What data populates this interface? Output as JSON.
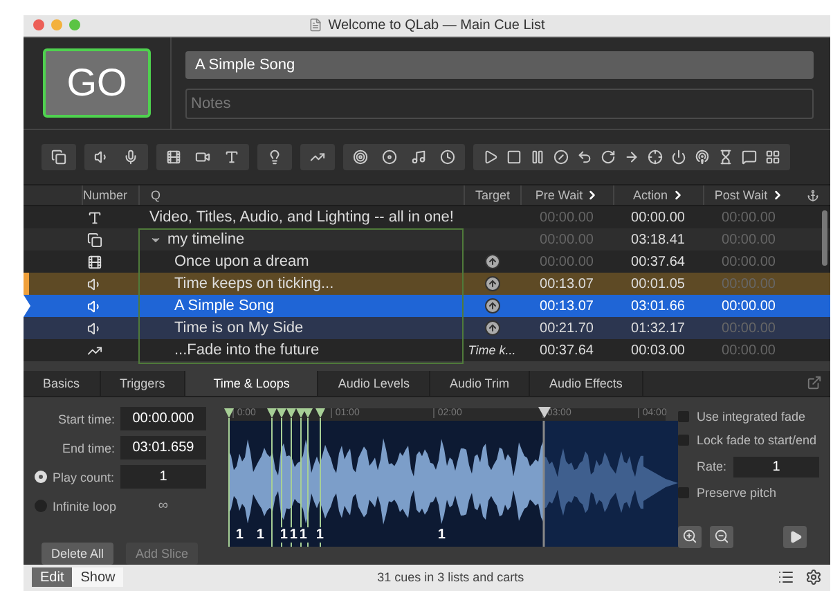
{
  "window": {
    "title": "Welcome to QLab — Main Cue List"
  },
  "go_button": {
    "label": "GO"
  },
  "cue_name": {
    "value": "A Simple Song"
  },
  "notes": {
    "placeholder": "Notes"
  },
  "toolbar_groups": [
    [
      {
        "kind": "group"
      }
    ],
    [
      {
        "kind": "audio"
      },
      {
        "kind": "mic"
      }
    ],
    [
      {
        "kind": "video"
      },
      {
        "kind": "camera"
      },
      {
        "kind": "text"
      }
    ],
    [
      {
        "kind": "light"
      }
    ],
    [
      {
        "kind": "fade"
      }
    ],
    [
      {
        "kind": "network"
      },
      {
        "kind": "midi"
      },
      {
        "kind": "music"
      },
      {
        "kind": "timecode"
      }
    ],
    [
      {
        "kind": "start"
      },
      {
        "kind": "stop"
      },
      {
        "kind": "pause"
      },
      {
        "kind": "load"
      },
      {
        "kind": "reset"
      },
      {
        "kind": "devamp"
      },
      {
        "kind": "goto"
      },
      {
        "kind": "target"
      },
      {
        "kind": "arm"
      },
      {
        "kind": "disarm"
      },
      {
        "kind": "wait"
      },
      {
        "kind": "memo"
      },
      {
        "kind": "script"
      }
    ]
  ],
  "columns": [
    {
      "label": "Number",
      "chevron": false
    },
    {
      "label": "Q",
      "chevron": false
    },
    {
      "label": "Target",
      "chevron": false
    },
    {
      "label": "Pre Wait",
      "chevron": true
    },
    {
      "label": "Action",
      "chevron": true
    },
    {
      "label": "Post Wait",
      "chevron": true
    }
  ],
  "cues": [
    {
      "kind": "text",
      "name": "Video, Titles, Audio, and Lighting -- all in one!",
      "selected": false,
      "pre_wait": "00:00.00",
      "pre_dim": true,
      "action": "00:00.00",
      "post_wait": "00:00.00",
      "post_dim": true
    },
    {
      "kind": "group",
      "name": "my timeline",
      "expanded": true,
      "selected": false,
      "pre_wait": "00:00.00",
      "pre_dim": true,
      "action": "03:18.41",
      "post_wait": "00:00.00",
      "post_dim": true,
      "children": [
        {
          "kind": "video",
          "name": "Once upon a dream",
          "selected": false,
          "target": {
            "kind": "arrow"
          },
          "pre_wait": "00:00.00",
          "pre_dim": true,
          "action": "00:37.64",
          "post_wait": "00:00.00",
          "post_dim": true
        },
        {
          "kind": "audio",
          "name": "Time keeps on ticking...",
          "selected": false,
          "color": "#5e4a25",
          "target": {
            "kind": "arrow"
          },
          "pre_wait": "00:13.07",
          "pre_dim": false,
          "action": "00:01.05",
          "post_wait": "00:00.00",
          "post_dim": true
        },
        {
          "kind": "audio",
          "name": "A Simple Song",
          "selected": true,
          "target": {
            "kind": "arrow"
          },
          "pre_wait": "00:13.07",
          "pre_dim": false,
          "action": "03:01.66",
          "post_wait": "00:00.00",
          "post_dim": false
        },
        {
          "kind": "audio",
          "name": "Time is on My Side",
          "selected": false,
          "color": "#2c3650",
          "target": {
            "kind": "arrow"
          },
          "pre_wait": "00:21.70",
          "pre_dim": false,
          "action": "01:32.17",
          "post_wait": "00:00.00",
          "post_dim": true
        },
        {
          "kind": "fade",
          "name": "...Fade into the future",
          "selected": false,
          "target": {
            "kind": "text",
            "text": "Time k..."
          },
          "pre_wait": "00:37.64",
          "pre_dim": false,
          "action": "00:03.00",
          "post_wait": "00:00.00",
          "post_dim": true
        }
      ]
    }
  ],
  "tabs": [
    {
      "label": "Basics",
      "selected": false
    },
    {
      "label": "Triggers",
      "selected": false
    },
    {
      "label": "Time & Loops",
      "selected": true
    },
    {
      "label": "Audio Levels",
      "selected": false
    },
    {
      "label": "Audio Trim",
      "selected": false
    },
    {
      "label": "Audio Effects",
      "selected": false
    }
  ],
  "start_time": {
    "label": "Start time:",
    "value": "00:00.000"
  },
  "end_time": {
    "label": "End time:",
    "value": "03:01.659"
  },
  "loop_options": [
    {
      "label": "Play count:",
      "selected": true,
      "value": "1"
    },
    {
      "label": "Infinite loop",
      "selected": false,
      "value": "∞"
    }
  ],
  "slice_buttons": [
    {
      "label": "Delete All",
      "disabled": false
    },
    {
      "label": "Add Slice",
      "disabled": true
    }
  ],
  "timeline_ticks": [
    "0:00",
    "01:00",
    "02:00",
    "03:00",
    "04:00"
  ],
  "slice_labels": [
    "1",
    "1",
    "1",
    "1",
    "1",
    "1",
    "1"
  ],
  "fade_options": [
    {
      "label": "Use integrated fade",
      "checked": false
    },
    {
      "label": "Lock fade to start/end",
      "checked": false
    }
  ],
  "rate": {
    "label": "Rate:",
    "value": "1"
  },
  "preserve_pitch": {
    "label": "Preserve pitch",
    "checked": false
  },
  "modes": [
    {
      "label": "Edit",
      "selected": true
    },
    {
      "label": "Show",
      "selected": false
    }
  ],
  "status": "31 cues in 3 lists and carts"
}
